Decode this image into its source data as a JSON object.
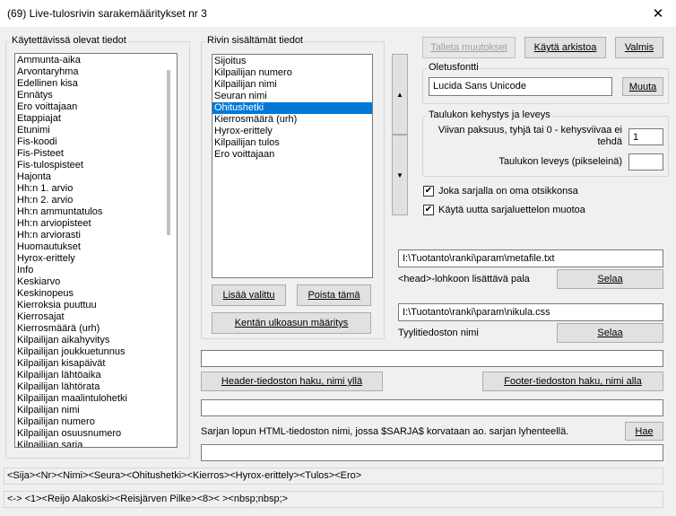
{
  "window": {
    "title": "(69) Live-tulosrivin sarakemääritykset  nr 3",
    "close_glyph": "✕"
  },
  "available": {
    "legend": "Käytettävissä olevat tiedot",
    "items": [
      "Ammunta-aika",
      "Arvontaryhma",
      "Edellinen kisa",
      "Ennätys",
      "Ero voittajaan",
      "Etappiajat",
      "Etunimi",
      "Fis-koodi",
      "Fis-Pisteet",
      "Fis-tulospisteet",
      "Hajonta",
      "Hh:n 1. arvio",
      "Hh:n 2. arvio",
      "Hh:n ammuntatulos",
      "Hh:n arviopisteet",
      "Hh:n arviorasti",
      "Huomautukset",
      "Hyrox-erittely",
      "Info",
      "Keskiarvo",
      "Keskinopeus",
      "Kierroksia puuttuu",
      "Kierrosajat",
      "Kierrosmäärä (urh)",
      "Kilpailijan aikahyvitys",
      "Kilpailijan joukkuetunnus",
      "Kilpailijan kisapäivät",
      "Kilpailijan lähtöaika",
      "Kilpailijan lähtörata",
      "Kilpailijan maalintulohetki",
      "Kilpailijan nimi",
      "Kilpailijan numero",
      "Kilpailijan osuusnumero",
      "Kilpailijan sarja"
    ]
  },
  "row": {
    "legend": "Rivin sisältämät tiedot",
    "items": [
      "Sijoitus",
      "Kilpailijan numero",
      "Kilpailijan nimi",
      "Seuran nimi",
      "Ohitushetki",
      "Kierrosmäärä (urh)",
      "Hyrox-erittely",
      "Kilpailijan tulos",
      "Ero voittajaan"
    ],
    "selected_index": 4,
    "add_label": "Lisää valittu",
    "remove_label": "Poista tämä",
    "field_look_label": "Kentän ulkoasun määritys",
    "up_arrow": "▲",
    "down_arrow": "▼"
  },
  "toolbar": {
    "save_label": "Talleta muutokset",
    "use_archive_label": "Käytä arkistoa",
    "ready_label": "Valmis"
  },
  "default_font": {
    "legend": "Oletusfontti",
    "value": "Lucida Sans Unicode",
    "change_label": "Muuta"
  },
  "table_border": {
    "legend": "Taulukon kehystys ja leveys",
    "line_label": "Viivan paksuus, tyhjä tai 0 - kehysviivaa ei tehdä",
    "line_value": "1",
    "width_label": "Taulukon leveys (pikseleinä)",
    "width_value": ""
  },
  "options": {
    "own_header_label": "Joka sarjalla on oma otsikkonsa",
    "own_header_checked": true,
    "new_list_label": "Käytä uutta sarjaluettelon muotoa",
    "new_list_checked": true,
    "check_glyph": "✔"
  },
  "files": {
    "meta_path": "I:\\Tuotanto\\ranki\\param\\metafile.txt",
    "meta_label": "<head>-lohkoon lisättävä pala",
    "browse_label": "Selaa",
    "css_path": "I:\\Tuotanto\\ranki\\param\\nikula.css",
    "css_label": "Tyylitiedoston nimi",
    "browse2_label": "Selaa"
  },
  "html_files": {
    "header_value": "",
    "header_button": "Header-tiedoston haku, nimi yllä",
    "footer_button": "Footer-tiedoston haku, nimi alla",
    "footer_value": "",
    "series_end_label": "Sarjan lopun HTML-tiedoston nimi, jossa $SARJA$ korvataan ao. sarjan lyhenteellä.",
    "fetch_label": "Hae",
    "series_end_value": ""
  },
  "preview": {
    "header_row": "<Sija><Nr><Nimi><Seura><Ohitushetki><Kierros><Hyrox-erittely><Tulos><Ero>",
    "sample_row": "<->  <1><Reijo Alakoski><Reisjärven Pilke><8><  ><nbsp;nbsp;>"
  }
}
